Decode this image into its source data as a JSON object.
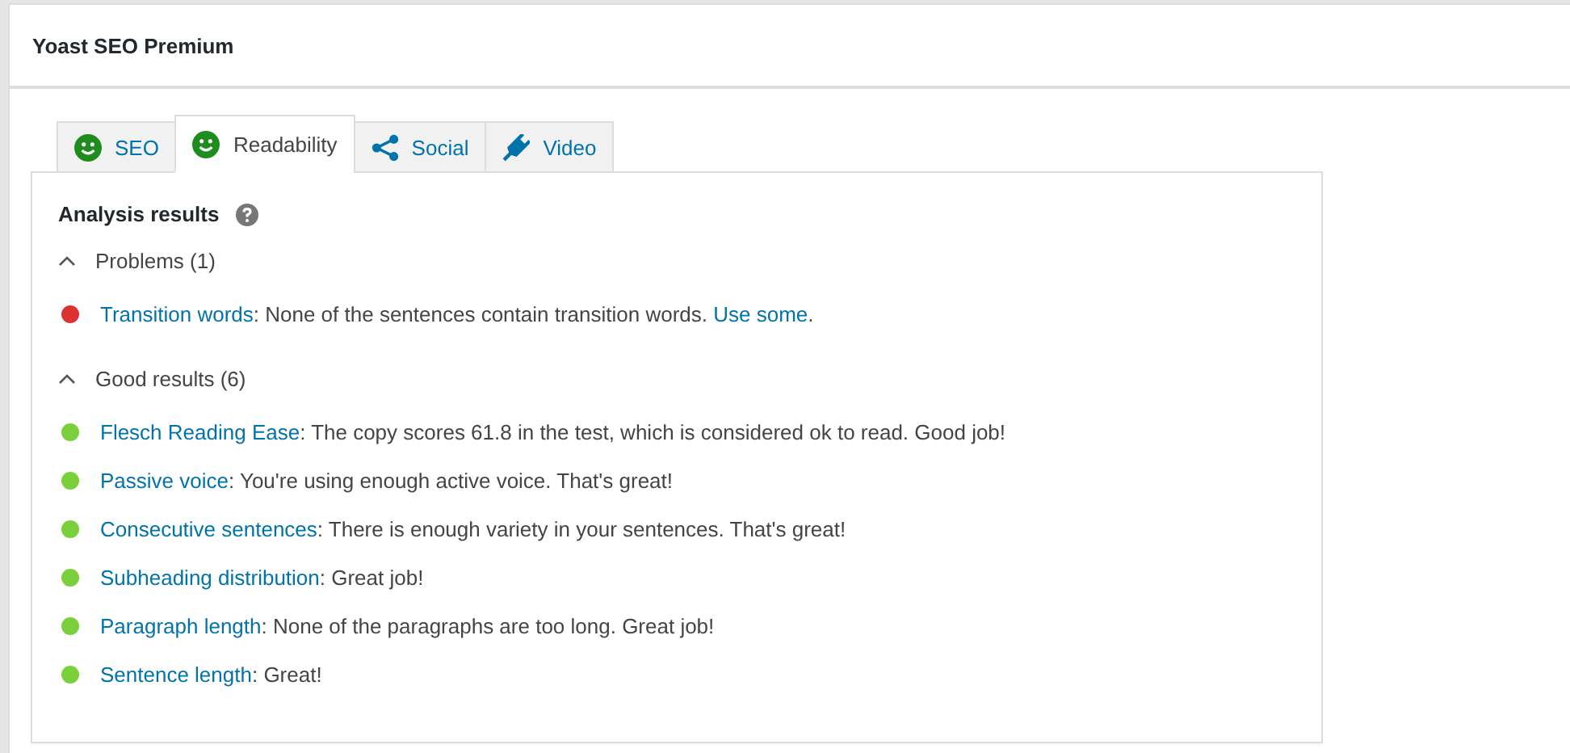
{
  "window": {
    "title": "Yoast SEO Premium"
  },
  "tabs": [
    {
      "label": "SEO",
      "kind": "score",
      "selected": false
    },
    {
      "label": "Readability",
      "kind": "score",
      "selected": true
    },
    {
      "label": "Social",
      "kind": "social",
      "selected": false
    },
    {
      "label": "Video",
      "kind": "video",
      "selected": false
    }
  ],
  "panel": {
    "heading": "Analysis results",
    "groups": [
      {
        "title": "Problems (1)",
        "expanded": true,
        "results": [
          {
            "color": "#dc3232",
            "link": "Transition words",
            "text": ": None of the sentences contain transition words. ",
            "action": "Use some",
            "end": "."
          }
        ]
      },
      {
        "title": "Good results (6)",
        "expanded": true,
        "results": [
          {
            "color": "#7ad03a",
            "link": "Flesch Reading Ease",
            "text": ": The copy scores 61.8 in the test, which is considered ok to read. Good job!"
          },
          {
            "color": "#7ad03a",
            "link": "Passive voice",
            "text": ": You're using enough active voice. That's great!"
          },
          {
            "color": "#7ad03a",
            "link": "Consecutive sentences",
            "text": ": There is enough variety in your sentences. That's great!"
          },
          {
            "color": "#7ad03a",
            "link": "Subheading distribution",
            "text": ": Great job!"
          },
          {
            "color": "#7ad03a",
            "link": "Paragraph length",
            "text": ": None of the paragraphs are too long. Great job!"
          },
          {
            "color": "#7ad03a",
            "link": "Sentence length",
            "text": ": Great!"
          }
        ]
      }
    ]
  }
}
